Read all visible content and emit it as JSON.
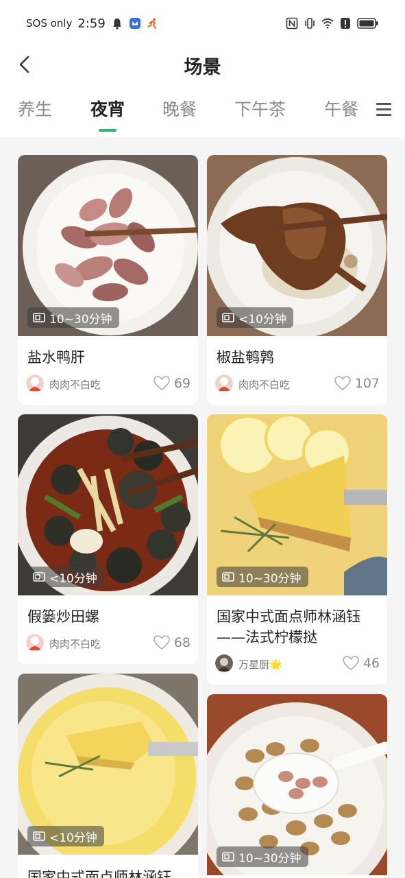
{
  "status_bar": {
    "carrier": "SOS only",
    "time": "2:59"
  },
  "header": {
    "title": "场景"
  },
  "tabs": [
    {
      "label": "养生",
      "active": false
    },
    {
      "label": "夜宵",
      "active": true
    },
    {
      "label": "晚餐",
      "active": false
    },
    {
      "label": "下午茶",
      "active": false
    },
    {
      "label": "午餐",
      "active": false
    }
  ],
  "colors": {
    "accent": "#2bb673",
    "tab_inactive": "#8a8a8a",
    "page_bg": "#f5f5f5"
  },
  "recipes": [
    {
      "title": "盐水鸭肝",
      "time": "10~30分钟",
      "author": "肉肉不白吃",
      "likes": "69",
      "image": "duck-liver-plate"
    },
    {
      "title": "椒盐鹌鹑",
      "time": "<10分钟",
      "author": "肉肉不白吃",
      "likes": "107",
      "image": "quail-plate"
    },
    {
      "title": "假篓炒田螺",
      "time": "<10分钟",
      "author": "肉肉不白吃",
      "likes": "68",
      "image": "snail-plate"
    },
    {
      "title": "国家中式面点师林涵钰——法式柠檬挞",
      "time": "10~30分钟",
      "author": "万星厨🌟",
      "likes": "46",
      "image": "lemon-tart"
    },
    {
      "title": "国家中式面点师林涵钰",
      "time": "<10分钟",
      "author": "",
      "likes": "",
      "image": "custard-bowl"
    },
    {
      "title": "",
      "time": "10~30分钟",
      "author": "",
      "likes": "",
      "image": "peanut-plate"
    }
  ]
}
